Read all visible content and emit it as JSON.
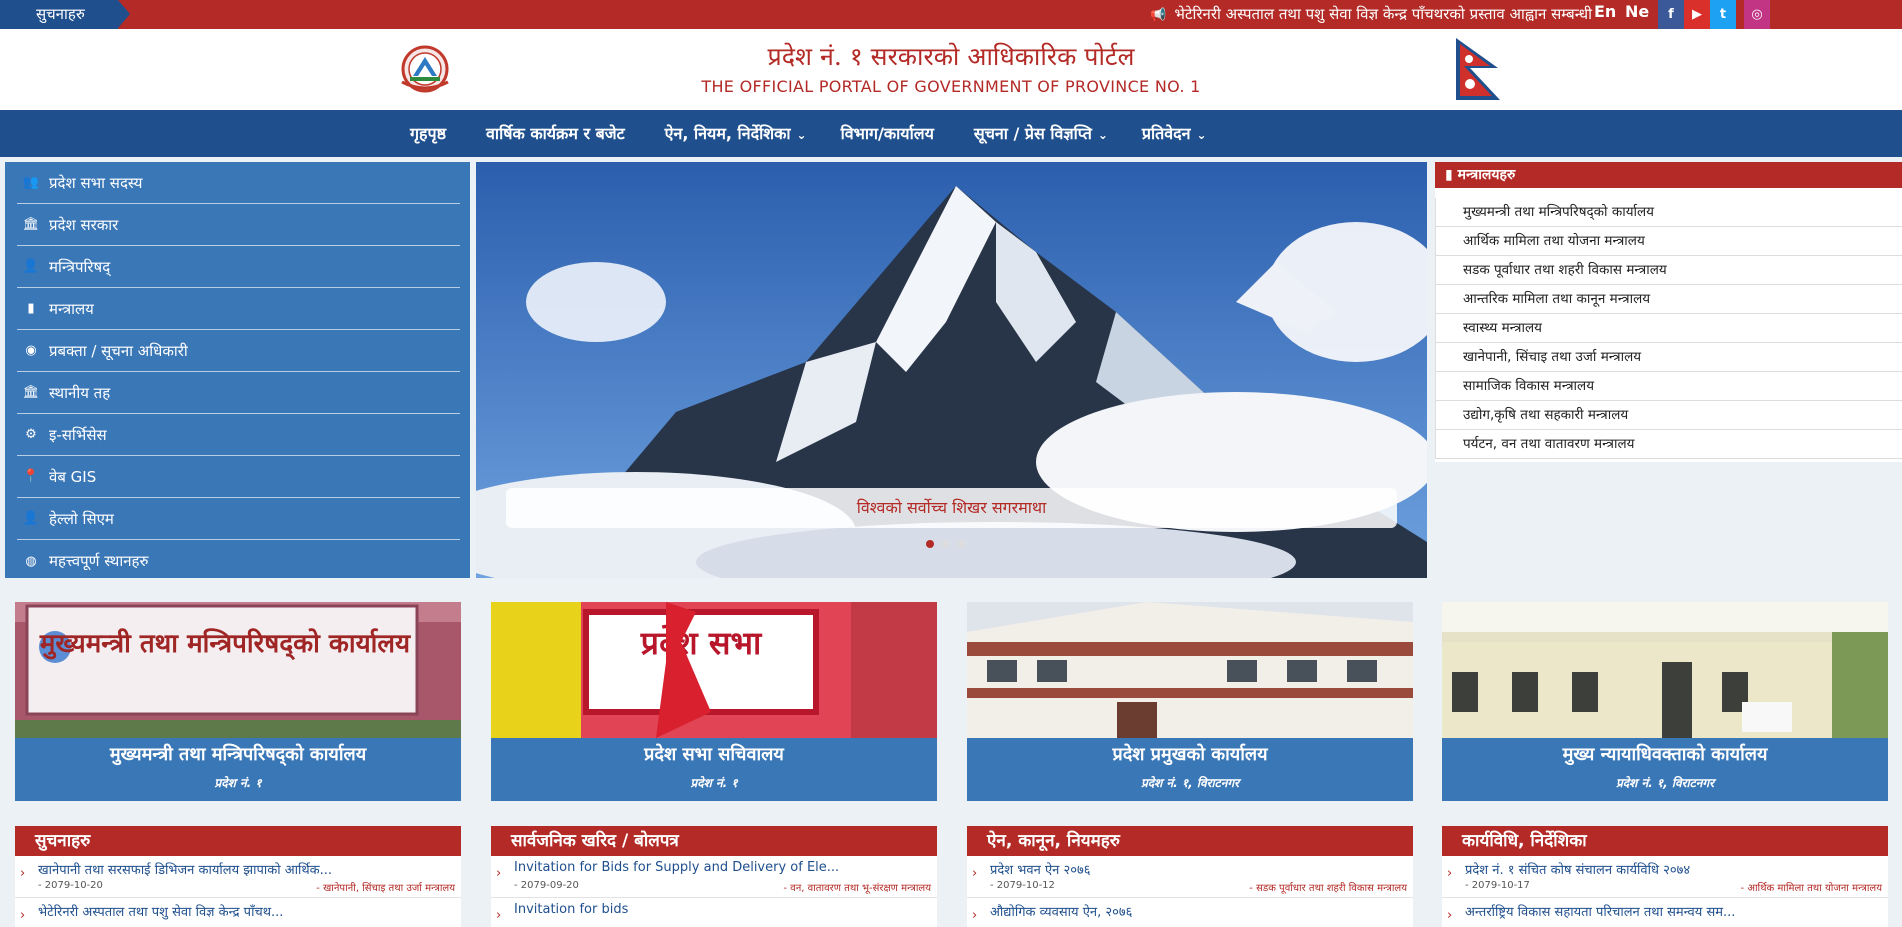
{
  "topbar": {
    "notices_tag": "सुचनाहरु",
    "ticker_text": "भेटेरिनरी अस्पताल तथा पशु सेवा विज्ञ केन्द्र पाँचथरको प्रस्ताव आह्वान सम्बन्धी",
    "lang_en": "En",
    "lang_ne": "Ne",
    "social": {
      "facebook": "f",
      "youtube": "▶",
      "twitter": "t",
      "instagram": "◎"
    }
  },
  "header": {
    "title_np": "प्रदेश नं. १ सरकारको आधिकारिक पोर्टल",
    "title_en": "THE OFFICIAL PORTAL OF GOVERNMENT OF PROVINCE NO. 1"
  },
  "nav": {
    "items": [
      {
        "label": "गृहपृष्ठ",
        "dropdown": ""
      },
      {
        "label": "वार्षिक कार्यक्रम र बजेट",
        "dropdown": ""
      },
      {
        "label": "ऐन, नियम, निर्देशिका",
        "dropdown": "⌄"
      },
      {
        "label": "विभाग/कार्यालय",
        "dropdown": ""
      },
      {
        "label": "सूचना / प्रेस विज्ञप्ति",
        "dropdown": "⌄"
      },
      {
        "label": "प्रतिवेदन",
        "dropdown": "⌄"
      }
    ]
  },
  "sidebar": {
    "items": [
      {
        "label": "प्रदेश सभा सदस्य",
        "icon": "users-icon"
      },
      {
        "label": "प्रदेश सरकार",
        "icon": "institution-icon"
      },
      {
        "label": "मन्त्रिपरिषद्",
        "icon": "user-icon"
      },
      {
        "label": "मन्त्रालय",
        "icon": "building-icon"
      },
      {
        "label": "प्रबक्ता / सूचना अधिकारी",
        "icon": "user-circle-icon"
      },
      {
        "label": "स्थानीय तह",
        "icon": "institution-icon"
      },
      {
        "label": "इ-सर्भिसेस",
        "icon": "gear-icon"
      },
      {
        "label": "वेब GIS",
        "icon": "map-marker-icon"
      },
      {
        "label": "हेल्लो सिएम",
        "icon": "user-icon"
      },
      {
        "label": "महत्त्वपूर्ण स्थानहरु",
        "icon": "globe-icon"
      }
    ]
  },
  "slider": {
    "caption": "विश्वको सर्वोच्च शिखर सगरमाथा",
    "slide_count": 3,
    "active_slide": 1
  },
  "ministries": {
    "title": "मन्त्रालयहरु",
    "items": [
      "मुख्यमन्त्री तथा मन्त्रिपरिषद्‌को कार्यालय",
      "आर्थिक मामिला तथा योजना मन्त्रालय",
      "सडक पूर्वाधार तथा शहरी विकास मन्त्रालय",
      "आन्तरिक मामिला तथा कानून मन्त्रालय",
      "स्वास्थ्य मन्त्रालय",
      "खानेपानी, सिंचाइ तथा उर्जा मन्त्रालय",
      "सामाजिक विकास मन्त्रालय",
      "उद्योग,कृषि तथा सहकारी मन्त्रालय",
      "पर्यटन, वन तथा वातावरण मन्त्रालय"
    ]
  },
  "offices": [
    {
      "title": "मुख्यमन्त्री तथा मन्त्रिपरिषद्‌को कार्यालय",
      "subtitle": "प्रदेश नं. १",
      "photo_text": "मुख्यमन्त्री तथा मन्त्रिपरिषद्‌को कार्यालय"
    },
    {
      "title": "प्रदेश सभा सचिवालय",
      "subtitle": "प्रदेश नं. १",
      "photo_text": "प्रदेश सभा"
    },
    {
      "title": "प्रदेश प्रमुखको कार्यालय",
      "subtitle": "प्रदेश नं. १, विराटनगर",
      "photo_text": ""
    },
    {
      "title": "मुख्य न्यायाधिवक्ताको कार्यालय",
      "subtitle": "प्रदेश नं. १, विराटनगर",
      "photo_text": ""
    }
  ],
  "news": [
    {
      "title": "सुचनाहरु",
      "items": [
        {
          "text": "खानेपानी तथा सरसफाई डिभिजन कार्यालय झापाको आर्थिक...",
          "date": "- 2079-10-20",
          "dept": "- खानेपानी, सिंचाइ तथा उर्जा मन्त्रालय"
        },
        {
          "text": "भेटेरिनरी अस्पताल तथा पशु सेवा विज्ञ केन्द्र पाँचथ...",
          "date": "",
          "dept": ""
        }
      ]
    },
    {
      "title": "सार्वजनिक खरिद / बोलपत्र",
      "items": [
        {
          "text": "Invitation for Bids for Supply and Delivery of Ele...",
          "date": "- 2079-09-20",
          "dept": "- वन, वातावरण तथा भू-संरक्षण मन्त्रालय"
        },
        {
          "text": "Invitation for bids",
          "date": "",
          "dept": ""
        }
      ]
    },
    {
      "title": "ऐन, कानून, नियमहरु",
      "items": [
        {
          "text": "प्रदेश भवन ऐन २०७६",
          "date": "- 2079-10-12",
          "dept": "- सडक पूर्वाधार तथा शहरी विकास मन्त्रालय"
        },
        {
          "text": "औद्योगिक व्यवसाय ऐन, २०७६",
          "date": "",
          "dept": ""
        }
      ]
    },
    {
      "title": "कार्यविधि, निर्देशिका",
      "items": [
        {
          "text": "प्रदेश नं. १ संचित कोष संचालन कार्यविधि २०७४",
          "date": "- 2079-10-17",
          "dept": "- आर्थिक मामिला तथा योजना मन्त्रालय"
        },
        {
          "text": "अन्तर्राष्ट्रिय विकास सहायता परिचालन तथा समन्वय सम...",
          "date": "",
          "dept": ""
        }
      ]
    }
  ],
  "colors": {
    "brand_red": "#b32a26",
    "brand_blue": "#1f4f8d",
    "sidebar_blue": "#3a77b7"
  }
}
